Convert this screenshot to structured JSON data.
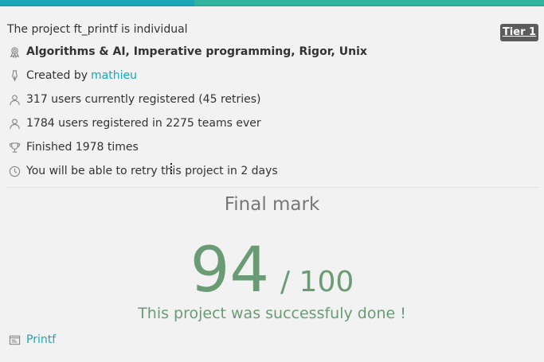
{
  "project": {
    "title": "The project ft_printf is individual",
    "tier": "Tier 1",
    "skills": "Algorithms & AI, Imperative programming, Rigor, Unix",
    "created_by_prefix": "Created by ",
    "creator": "mathieu",
    "current_users": "317 users currently registered (45 retries)",
    "total_users": "1784 users registered in 2275 teams ever",
    "finished": "Finished 1978 times",
    "retry": "You will be able to retry this project in 2 days"
  },
  "result": {
    "label": "Final mark",
    "score": "94",
    "max": "/ 100",
    "message": "This project was successfuly done !"
  },
  "subject": {
    "link": "Printf"
  },
  "icons": {
    "skills": "medal-icon",
    "creator": "pen-icon",
    "users_current": "user-icon",
    "users_total": "user-icon",
    "finished": "trophy-icon",
    "retry": "clock-icon",
    "subject": "document-icon"
  },
  "colors": {
    "accent": "#1aa7b7",
    "success": "#6b9b74",
    "tier_badge": "#5c5c5c"
  }
}
